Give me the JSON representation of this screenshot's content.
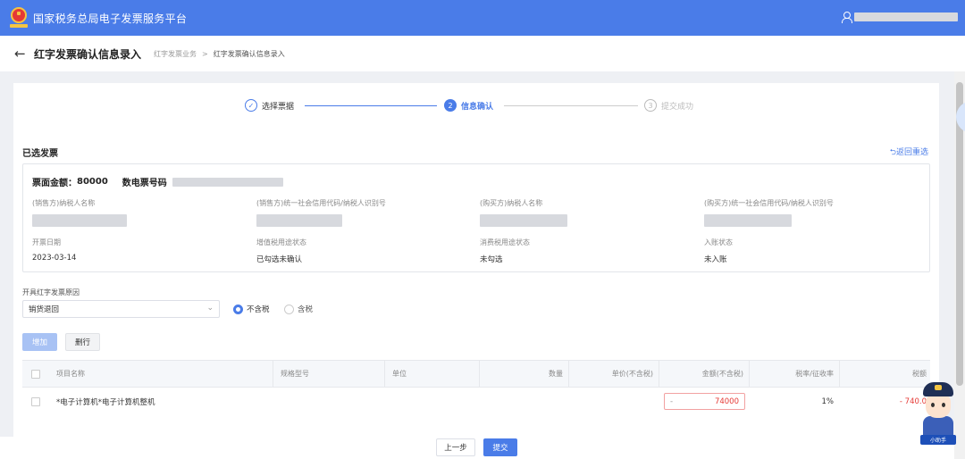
{
  "topbar": {
    "title": "国家税务总局电子发票服务平台",
    "logo_icon": "emblem-logo",
    "user_icon": "user-icon"
  },
  "header": {
    "back_icon": "←",
    "title": "红字发票确认信息录入",
    "breadcrumb": [
      "红字发票业务",
      "红字发票确认信息录入"
    ],
    "breadcrumb_sep": ">"
  },
  "steps": [
    {
      "icon": "✓",
      "label": "选择票据",
      "state": "done"
    },
    {
      "icon": "2",
      "label": "信息确认",
      "state": "active"
    },
    {
      "icon": "3",
      "label": "提交成功",
      "state": "pending"
    }
  ],
  "selected_invoice": {
    "section_title": "已选发票",
    "reselect_label": "⮌返回重选",
    "amount_label": "票面金额：",
    "amount_value": "80000",
    "number_label": "数电票号码",
    "fields": [
      {
        "label": "(销售方)纳税人名称",
        "value": ""
      },
      {
        "label": "(销售方)统一社会信用代码/纳税人识别号",
        "value": ""
      },
      {
        "label": "(购买方)纳税人名称",
        "value": ""
      },
      {
        "label": "(购买方)统一社会信用代码/纳税人识别号",
        "value": ""
      },
      {
        "label": "开票日期",
        "value": "2023-03-14"
      },
      {
        "label": "增值税用途状态",
        "value": "已勾选未确认"
      },
      {
        "label": "消费税用途状态",
        "value": "未勾选"
      },
      {
        "label": "入账状态",
        "value": "未入账"
      }
    ]
  },
  "reason": {
    "label": "开具红字发票原因",
    "selected": "销货退回",
    "chevron": "⌄"
  },
  "tax_mode": {
    "options": [
      "不含税",
      "含税"
    ],
    "selected": "不含税"
  },
  "toolbar": {
    "add_label": "增加",
    "delete_label": "删行"
  },
  "table": {
    "headers": [
      "项目名称",
      "规格型号",
      "单位",
      "数量",
      "单价(不含税)",
      "金额(不含税)",
      "税率/征收率",
      "税额"
    ],
    "rows": [
      {
        "name": "*电子计算机*电子计算机整机",
        "spec": "",
        "unit": "",
        "qty": "",
        "price": "",
        "amount_prefix": "-",
        "amount": "74000",
        "rate": "1%",
        "tax": "- 740.0"
      }
    ]
  },
  "footer": {
    "prev_label": "上一步",
    "submit_label": "提交"
  },
  "assistant": {
    "label": "小助手"
  },
  "colors": {
    "primary": "#4a7ce8",
    "negative": "#e53935"
  }
}
